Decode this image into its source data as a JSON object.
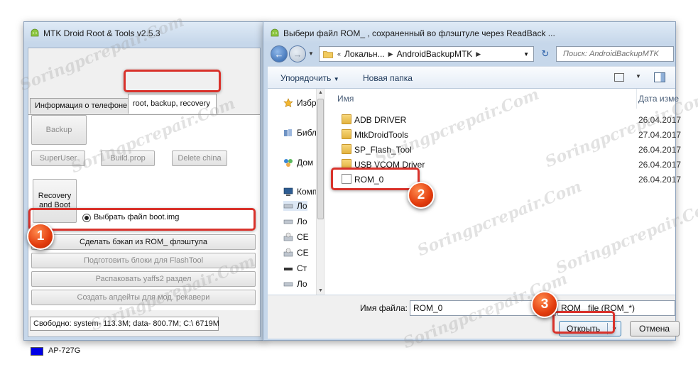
{
  "left_window": {
    "title": "MTK Droid Root & Tools v2.5.3",
    "tabs": [
      "Информация о телефоне",
      "root, backup, recovery"
    ],
    "buttons": {
      "backup": "Backup",
      "superuser": "SuperUser",
      "build_prop": "Build.prop",
      "delete_china": "Delete china",
      "recovery_boot_line1": "Recovery",
      "recovery_boot_line2": "and Boot",
      "make_backup": "Сделать бэкап из ROM_ флэштула",
      "prepare_blocks": "Подготовить блоки для FlashTool",
      "unpack_yaffs": "Распаковать yaffs2 раздел",
      "create_updates": "Создать апдейты для мод. рекавери"
    },
    "radio_label": "Выбрать файл boot.img",
    "status_free": "Свободно: system- 113.3M; data- 800.7M;  C:\\ 6719M",
    "device_name": "AP-727G",
    "device_color": "#0000e6"
  },
  "dialog": {
    "title": "Выбери файл ROM_ , сохраненный во флэштуле через ReadBack ...",
    "address": {
      "prefix": "«",
      "segments": [
        "Локальн...",
        "AndroidBackupMTK"
      ]
    },
    "search_placeholder": "Поиск: AndroidBackupMTK",
    "toolbar": {
      "organize": "Упорядочить",
      "new_folder": "Новая папка"
    },
    "nav_pane": [
      {
        "label": "Избр",
        "icon": "star-icon"
      },
      {
        "label": "Библ",
        "icon": "library-icon"
      },
      {
        "label": "Дом",
        "icon": "homegroup-icon"
      },
      {
        "label": "Комп",
        "icon": "computer-icon"
      },
      {
        "label": "Ло",
        "icon": "drive-icon"
      },
      {
        "label": "Ло",
        "icon": "drive-icon"
      },
      {
        "label": "CE",
        "icon": "cd-drive-icon"
      },
      {
        "label": "CE",
        "icon": "cd-drive-icon"
      },
      {
        "label": "Ст",
        "icon": "removable-drive-icon"
      },
      {
        "label": "Ло",
        "icon": "drive-icon"
      }
    ],
    "columns": {
      "name": "Имя",
      "date": "Дата изме"
    },
    "files": [
      {
        "name": "ADB DRIVER",
        "date": "26.04.2017",
        "type": "folder"
      },
      {
        "name": "MtkDroidTools",
        "date": "27.04.2017",
        "type": "folder"
      },
      {
        "name": "SP_Flash_Tool",
        "date": "26.04.2017",
        "type": "folder"
      },
      {
        "name": "USB VCOM Driver",
        "date": "26.04.2017",
        "type": "folder"
      },
      {
        "name": "ROM_0",
        "date": "26.04.2017",
        "type": "file"
      }
    ],
    "filename_label": "Имя файла:",
    "filename_value": "ROM_0",
    "filter": "ROM_ file (ROM_*)",
    "open_label": "Открыть",
    "cancel_label": "Отмена"
  },
  "annotations": {
    "badge_1": "1",
    "badge_2": "2",
    "badge_3": "3",
    "highlight_color": "#d9322b",
    "badge_color": "#e23b0d"
  },
  "watermark_text": "Soringpcrepair.Com"
}
